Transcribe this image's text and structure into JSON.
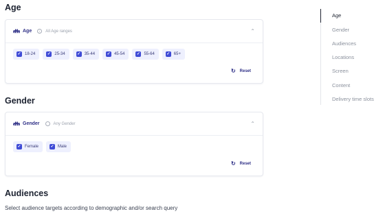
{
  "sections": {
    "age": {
      "title": "Age",
      "card_label": "Age",
      "card_desc": "All Age ranges",
      "chips": [
        "18-24",
        "25-34",
        "35-44",
        "45-54",
        "55-64",
        "65+"
      ],
      "reset_label": "Reset"
    },
    "gender": {
      "title": "Gender",
      "card_label": "Gender",
      "card_desc": "Any Gender",
      "chips": [
        "Female",
        "Male"
      ],
      "reset_label": "Reset"
    },
    "audiences": {
      "title": "Audiences",
      "description": "Select audience targets according to demographic and/or search query"
    }
  },
  "toc": {
    "items": [
      "Age",
      "Gender",
      "Audiences",
      "Locations",
      "Screen",
      "Content",
      "Delivery time slots"
    ],
    "active_index": 0
  },
  "icons": {
    "people": "people-icon",
    "info": "info-icon",
    "chevron": "chevron-up-icon",
    "checkbox": "checkbox-checked-icon",
    "reset": "reset-icon"
  },
  "colors": {
    "accent": "#3f4bd6",
    "label": "#2e2f86",
    "chip_bg": "#eef0fe"
  }
}
